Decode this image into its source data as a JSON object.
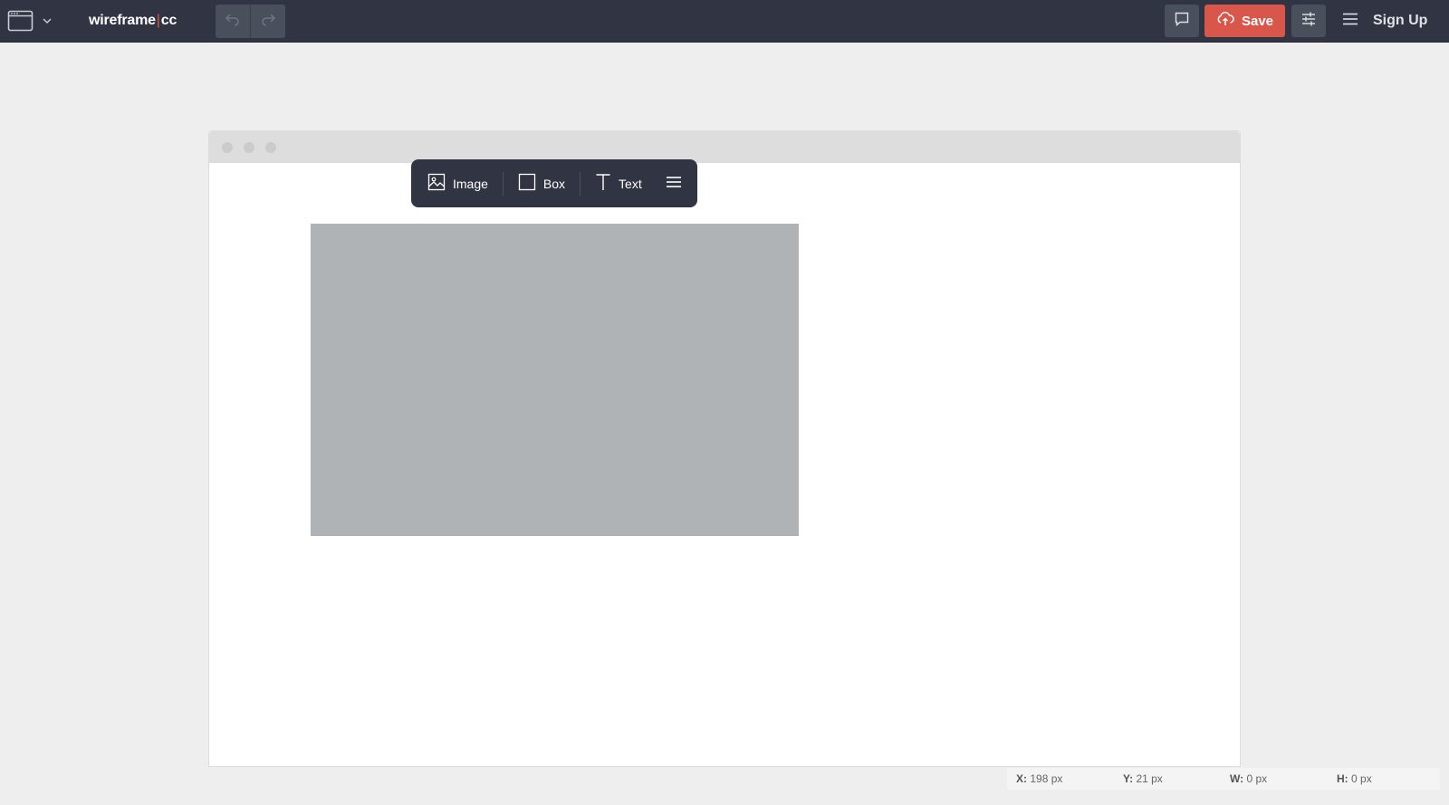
{
  "app": {
    "brand_name": "wireframe",
    "brand_separator": "|",
    "brand_suffix": "cc"
  },
  "topbar": {
    "save_label": "Save",
    "signup_label": "Sign Up",
    "icons": {
      "frame_type": "browser-window-icon",
      "frame_dropdown": "chevron-down-icon",
      "undo": "undo-icon",
      "redo": "redo-icon",
      "comment": "comment-icon",
      "save": "cloud-upload-icon",
      "settings": "sliders-icon",
      "menu": "hamburger-icon"
    }
  },
  "element_toolbar": {
    "items": [
      {
        "label": "Image",
        "icon": "image-icon"
      },
      {
        "label": "Box",
        "icon": "square-icon"
      },
      {
        "label": "Text",
        "icon": "text-t-icon"
      }
    ],
    "more_icon": "hamburger-icon"
  },
  "status": {
    "x_label": "X:",
    "x_value": "198 px",
    "y_label": "Y:",
    "y_value": "21 px",
    "w_label": "W:",
    "w_value": "0 px",
    "h_label": "H:",
    "h_value": "0 px"
  },
  "colors": {
    "topbar_bg": "#313543",
    "save_accent": "#d9574a",
    "canvas_bg": "#eeeeee",
    "placeholder_fill": "#b0b3b5"
  }
}
